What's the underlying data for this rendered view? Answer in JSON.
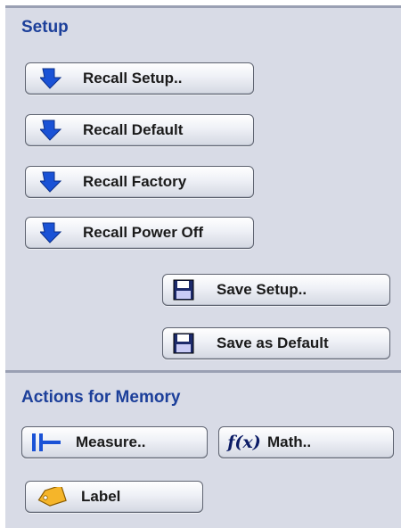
{
  "setup": {
    "title": "Setup",
    "recall_buttons": [
      {
        "label": "Recall Setup..",
        "icon": "recall-arrow-icon"
      },
      {
        "label": "Recall Default",
        "icon": "recall-arrow-icon"
      },
      {
        "label": "Recall Factory",
        "icon": "recall-arrow-icon"
      },
      {
        "label": "Recall Power Off",
        "icon": "recall-arrow-icon"
      }
    ],
    "save_buttons": [
      {
        "label": "Save Setup..",
        "icon": "floppy-disk-icon"
      },
      {
        "label": "Save as Default",
        "icon": "floppy-disk-icon"
      }
    ]
  },
  "memory": {
    "title": "Actions for Memory",
    "measure": {
      "label": "Measure..",
      "icon": "measure-cursor-icon"
    },
    "math": {
      "label": "Math..",
      "icon": "math-function-icon",
      "icon_text": "f(x)"
    },
    "label": {
      "label": "Label",
      "icon": "tag-icon"
    }
  },
  "colors": {
    "section_title": "#1c3f9a",
    "panel_background": "#d8dbe6",
    "recall_icon": "#1a52d6",
    "tag_icon": "#f5b52a"
  }
}
